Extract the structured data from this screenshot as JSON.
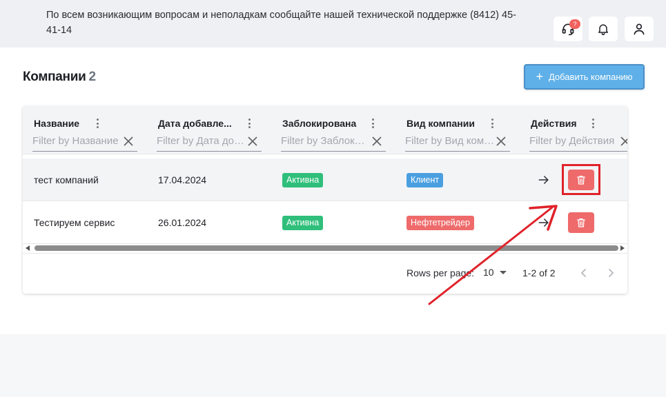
{
  "header": {
    "notice": "По всем возникающим вопросам и неполадкам сообщайте нашей технической поддержке (8412) 45-41-14",
    "support_badge": "?"
  },
  "page": {
    "title": "Компании",
    "count": "2",
    "add_button": "Добавить компанию"
  },
  "grid": {
    "columns": [
      {
        "title": "Название",
        "filter_placeholder": "Filter by Название"
      },
      {
        "title": "Дата добавле...",
        "filter_placeholder": "Filter by Дата добавления"
      },
      {
        "title": "Заблокирована",
        "filter_placeholder": "Filter by Заблокирована"
      },
      {
        "title": "Вид компании",
        "filter_placeholder": "Filter by Вид компании"
      },
      {
        "title": "Действия",
        "filter_placeholder": "Filter by Действия"
      }
    ],
    "rows": [
      {
        "name": "тест компаний",
        "date": "17.04.2024",
        "status": "Активна",
        "type": "Клиент"
      },
      {
        "name": "Тестируем сервис",
        "date": "26.01.2024",
        "status": "Активна",
        "type": "Нефтетрейдер"
      }
    ],
    "footer": {
      "rows_per_page_label": "Rows per page:",
      "rows_per_page_value": "10",
      "range": "1-2 of 2"
    }
  },
  "colors": {
    "topbar_bg": "#eef0f4",
    "accent_blue": "#5fb0e8",
    "tag_green": "#2fbf7b",
    "tag_blue": "#4a9fe0",
    "tag_red": "#ef6a6a",
    "annotation_red": "#e0222a"
  },
  "icons": {
    "support": "headset-icon",
    "notifications": "bell-icon",
    "profile": "user-icon",
    "open": "arrow-right-icon",
    "delete": "trash-icon"
  }
}
